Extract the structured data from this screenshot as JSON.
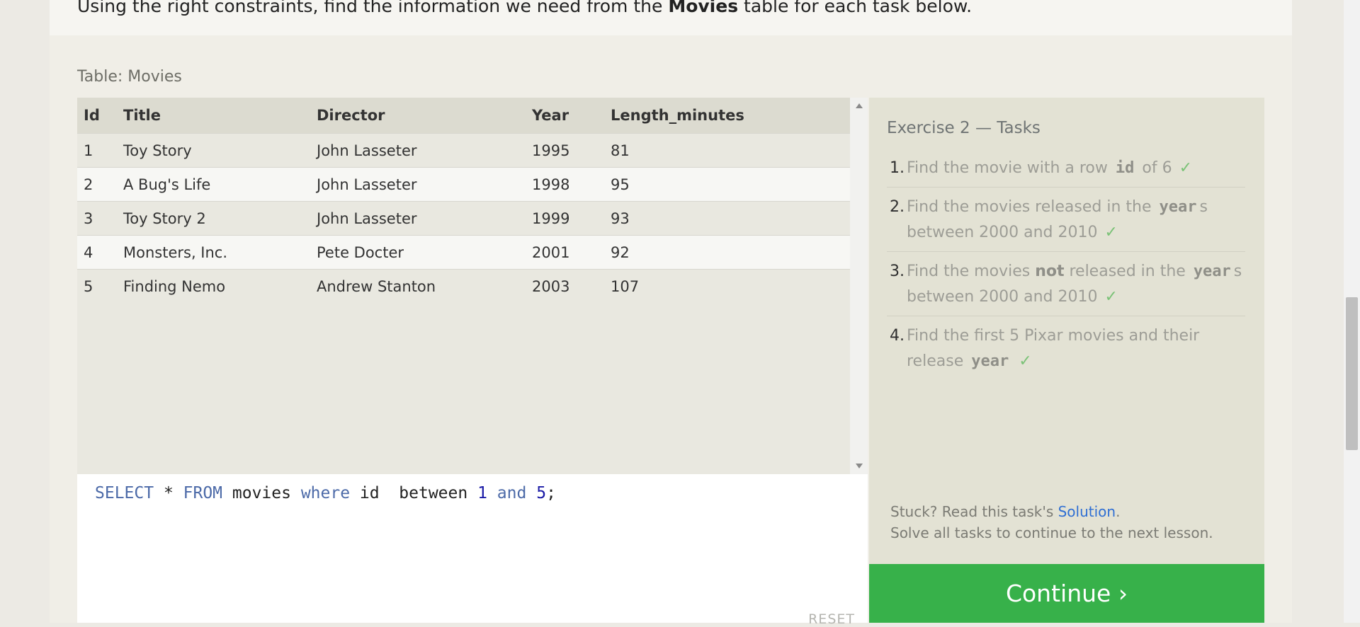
{
  "intro": {
    "prefix": "Using the right constraints, find the information we need from the ",
    "table_name": "Movies",
    "suffix": " table for each task below."
  },
  "table_caption": "Table: Movies",
  "table": {
    "columns": [
      "Id",
      "Title",
      "Director",
      "Year",
      "Length_minutes"
    ],
    "rows": [
      [
        "1",
        "Toy Story",
        "John Lasseter",
        "1995",
        "81"
      ],
      [
        "2",
        "A Bug's Life",
        "John Lasseter",
        "1998",
        "95"
      ],
      [
        "3",
        "Toy Story 2",
        "John Lasseter",
        "1999",
        "93"
      ],
      [
        "4",
        "Monsters, Inc.",
        "Pete Docter",
        "2001",
        "92"
      ],
      [
        "5",
        "Finding Nemo",
        "Andrew Stanton",
        "2003",
        "107"
      ]
    ]
  },
  "editor": {
    "tokens": [
      {
        "t": "SELECT",
        "c": "kw"
      },
      {
        "t": " * ",
        "c": ""
      },
      {
        "t": "FROM",
        "c": "kw"
      },
      {
        "t": " movies ",
        "c": ""
      },
      {
        "t": "where",
        "c": "kw"
      },
      {
        "t": " id  between ",
        "c": ""
      },
      {
        "t": "1",
        "c": "num"
      },
      {
        "t": " ",
        "c": ""
      },
      {
        "t": "and",
        "c": "kw"
      },
      {
        "t": " ",
        "c": ""
      },
      {
        "t": "5",
        "c": "num"
      },
      {
        "t": ";",
        "c": ""
      }
    ],
    "reset_label": "RESET"
  },
  "tasks": {
    "title": "Exercise 2 — Tasks",
    "items": [
      {
        "num": "1.",
        "parts": [
          {
            "t": "Find the movie with a row ",
            "s": ""
          },
          {
            "t": "id",
            "s": "mono"
          },
          {
            "t": " of 6",
            "s": ""
          }
        ]
      },
      {
        "num": "2.",
        "parts": [
          {
            "t": "Find the movies released in the ",
            "s": ""
          },
          {
            "t": "year",
            "s": "mono"
          },
          {
            "t": "s between 2000 and 2010",
            "s": ""
          }
        ]
      },
      {
        "num": "3.",
        "parts": [
          {
            "t": "Find the movies ",
            "s": ""
          },
          {
            "t": "not",
            "s": "strong"
          },
          {
            "t": " released in the ",
            "s": ""
          },
          {
            "t": "year",
            "s": "mono"
          },
          {
            "t": "s between 2000 and 2010",
            "s": ""
          }
        ]
      },
      {
        "num": "4.",
        "parts": [
          {
            "t": "Find the first 5 Pixar movies and their release ",
            "s": ""
          },
          {
            "t": "year",
            "s": "mono"
          }
        ]
      }
    ],
    "check_mark": "✓"
  },
  "help": {
    "stuck_prefix": "Stuck? Read this task's ",
    "solution_link": "Solution",
    "stuck_suffix": ".",
    "solve_all": "Solve all tasks to continue to the next lesson."
  },
  "continue_label": "Continue ›"
}
